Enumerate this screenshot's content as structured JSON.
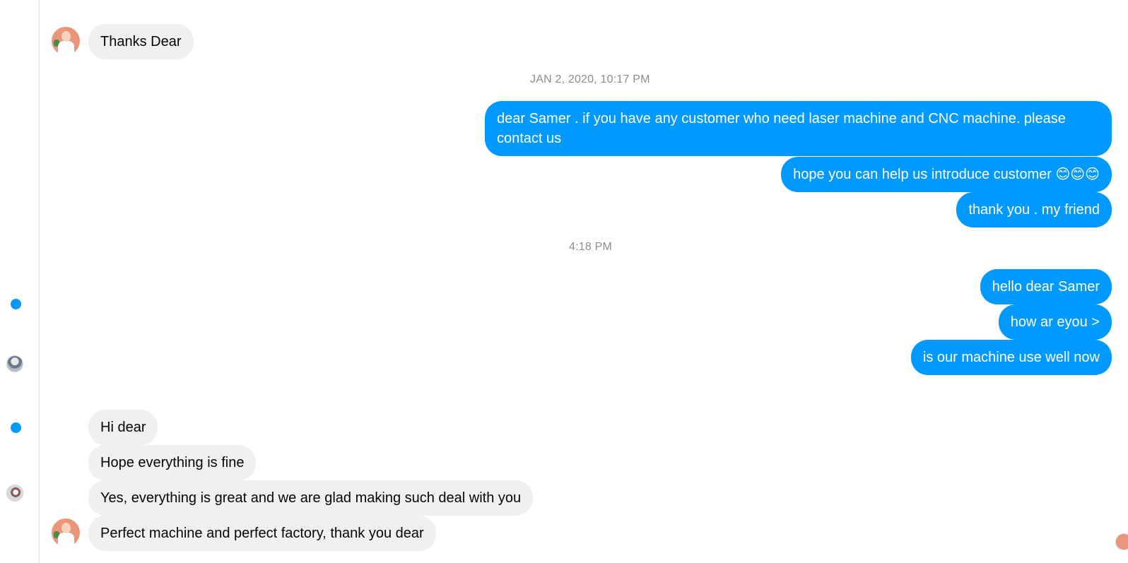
{
  "sidebar": {
    "unread_color": "#0099ff"
  },
  "thread": {
    "first_message": "Thanks Dear",
    "timestamp_1": "JAN 2, 2020, 10:17 PM",
    "outgoing_1": [
      "dear Samer . if you have any customer who need laser machine and CNC machine. please contact us",
      "hope you can help us introduce customer 😊😊😊",
      "thank you . my friend"
    ],
    "timestamp_2": "4:18 PM",
    "outgoing_2": [
      "hello dear Samer",
      "how ar eyou >",
      "is our machine use well now"
    ],
    "incoming_2": [
      "Hi dear",
      "Hope everything is fine",
      "Yes, everything is great and we are glad making such deal with you",
      "Perfect machine and perfect factory, thank you dear"
    ]
  },
  "colors": {
    "outgoing_bubble": "#0099ff",
    "incoming_bubble": "#f0f0f0",
    "timestamp_text": "#8a8d91"
  }
}
